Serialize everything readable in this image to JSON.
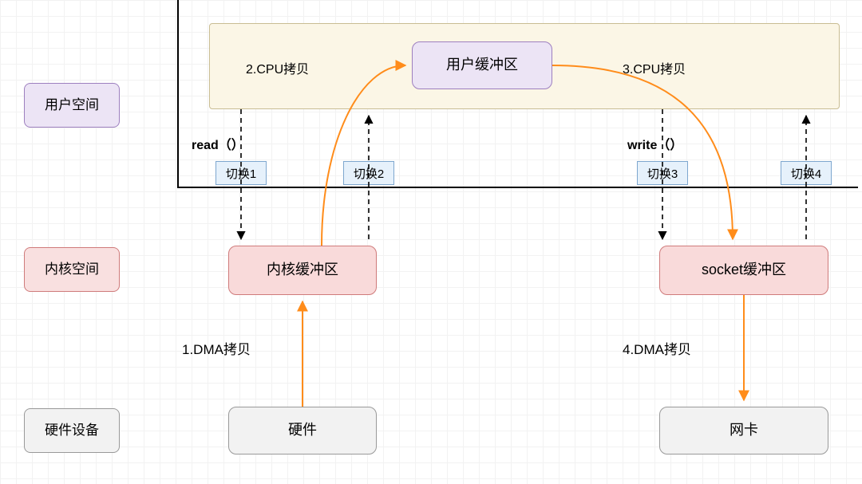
{
  "sidebar": {
    "user_space": "用户空间",
    "kernel_space": "内核空间",
    "hw_devices": "硬件设备"
  },
  "envelope": {
    "cpu_copy_left": "2.CPU拷贝",
    "cpu_copy_right": "3.CPU拷贝",
    "user_buffer": "用户缓冲区"
  },
  "syscalls": {
    "read": "read（）",
    "write": "write（）"
  },
  "switches": {
    "s1": "切换1",
    "s2": "切换2",
    "s3": "切换3",
    "s4": "切换4"
  },
  "kernel": {
    "kernel_buffer": "内核缓冲区",
    "socket_buffer": "socket缓冲区"
  },
  "dma": {
    "left": "1.DMA拷贝",
    "right": "4.DMA拷贝"
  },
  "hw": {
    "hardware": "硬件",
    "nic": "网卡"
  }
}
